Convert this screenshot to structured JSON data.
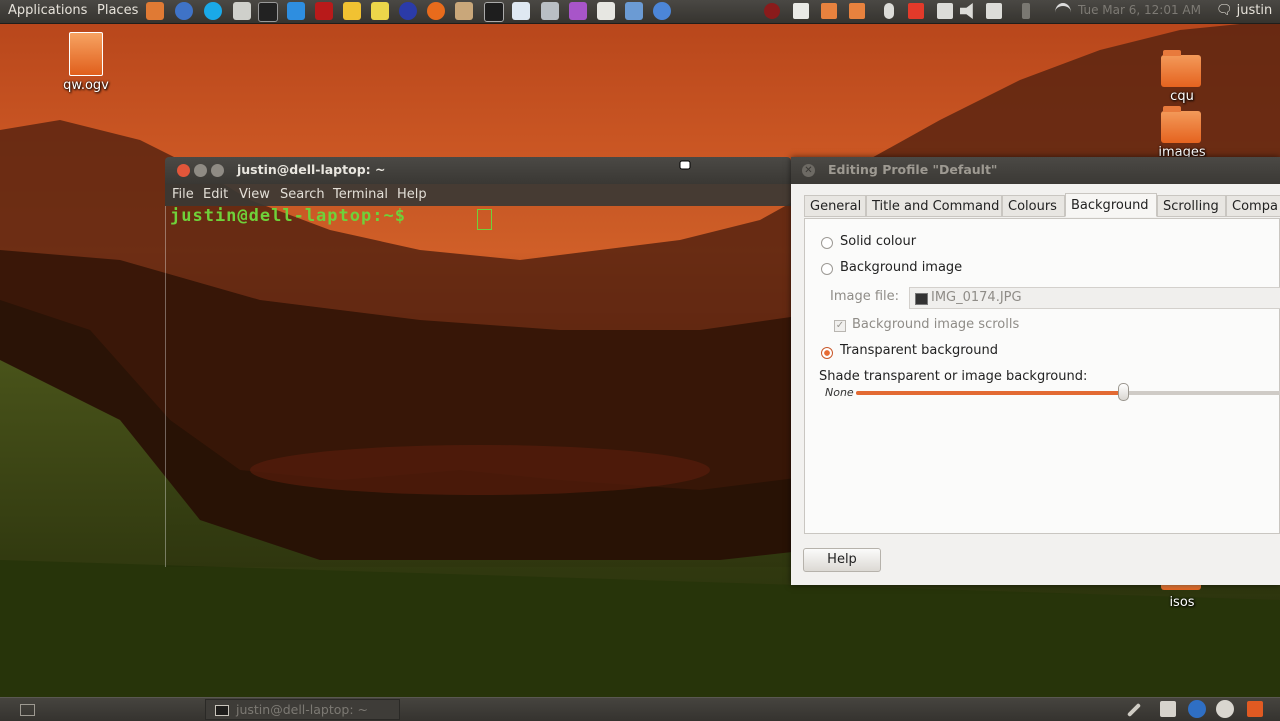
{
  "top_panel": {
    "applications": "Applications",
    "places": "Places",
    "clock": "Tue Mar 6, 12:01 AM",
    "user": "justin",
    "launchers": [
      "folder-icon",
      "thunderbird-icon",
      "skype-icon",
      "usb-icon",
      "system-monitor-icon",
      "dropbox-icon",
      "filezilla-icon",
      "cad-icon",
      "notes-icon",
      "globe-icon",
      "firefox-icon",
      "file-manager-icon",
      "terminal-icon",
      "screenshot-icon",
      "pidgin-icon",
      "settings-icon",
      "printer-icon",
      "network-icon",
      "chromium-icon"
    ],
    "tray": [
      "chat-icon",
      "document-icon",
      "folder-icon",
      "download-icon",
      "microphone-icon",
      "record-icon",
      "mail-icon",
      "volume-icon",
      "edit-icon",
      "bluetooth-icon",
      "wifi-icon"
    ]
  },
  "desktop": {
    "icons": [
      {
        "name": "qw-video-file",
        "label": "qw.ogv"
      },
      {
        "name": "cqu-folder",
        "label": "cqu"
      },
      {
        "name": "images-folder",
        "label": "images"
      },
      {
        "name": "isos-folder",
        "label": "isos"
      }
    ]
  },
  "terminal": {
    "title": "justin@dell-laptop: ~",
    "menu": [
      "File",
      "Edit",
      "View",
      "Search",
      "Terminal",
      "Help"
    ],
    "prompt": "justin@dell-laptop:~$"
  },
  "dialog": {
    "title": "Editing Profile \"Default\"",
    "tabs": [
      "General",
      "Title and Command",
      "Colours",
      "Background",
      "Scrolling",
      "Compa"
    ],
    "active_tab": "Background",
    "options": {
      "solid": "Solid colour",
      "image": "Background image",
      "image_file_label": "Image file:",
      "image_file_value": "IMG_0174.JPG",
      "image_scrolls": "Background image scrolls",
      "transparent": "Transparent background",
      "shade_label": "Shade transparent or image background:",
      "shade_min": "None",
      "shade_level": 0.62
    },
    "help": "Help"
  },
  "bottom_panel": {
    "task": "justin@dell-laptop: ~",
    "tray": [
      "pen-icon",
      "keyboard-icon",
      "update-icon",
      "network-manager-icon",
      "trash-icon"
    ]
  }
}
